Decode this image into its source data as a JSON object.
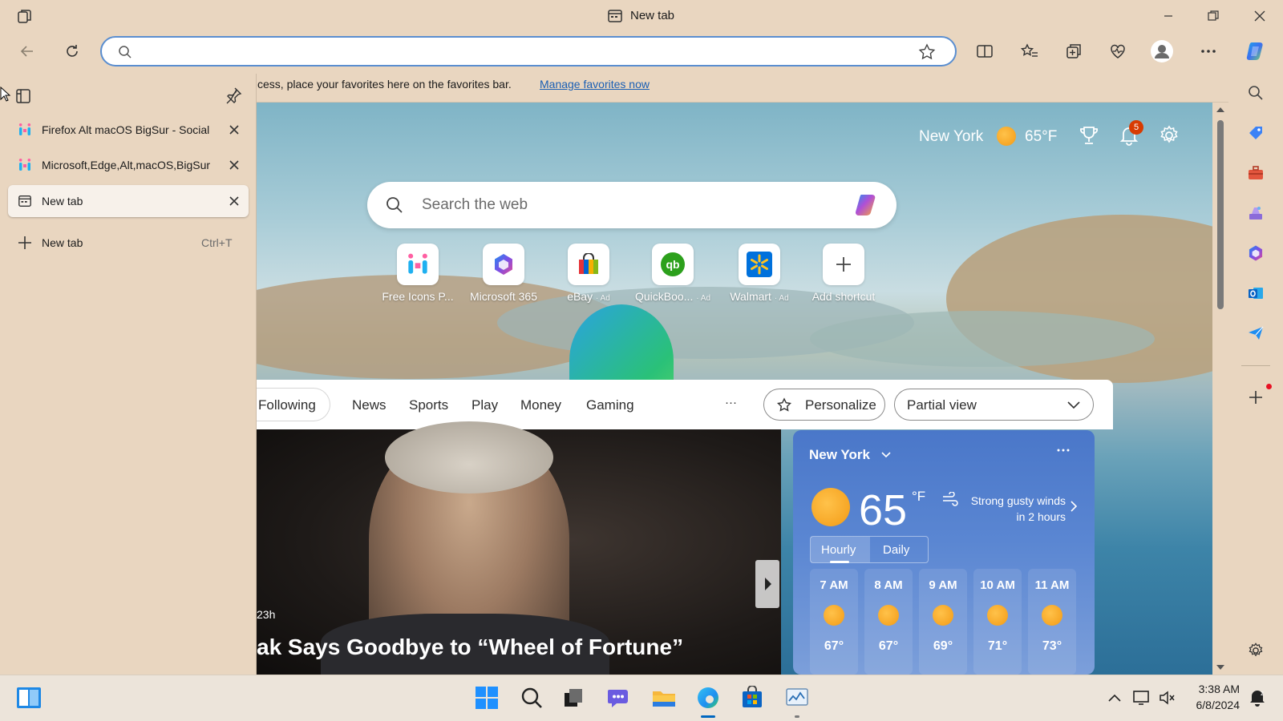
{
  "window": {
    "title": "New tab"
  },
  "address_bar": {
    "value": "",
    "placeholder": ""
  },
  "vertical_tabs": {
    "tabs": [
      {
        "label": "Firefox Alt macOS BigSur - Social"
      },
      {
        "label": "Microsoft,Edge,Alt,macOS,BigSur"
      },
      {
        "label": "New tab",
        "active": true
      }
    ],
    "new_tab_label": "New tab",
    "new_tab_shortcut": "Ctrl+T"
  },
  "favorites_bar": {
    "message": "cess, place your favorites here on the favorites bar.",
    "link": "Manage favorites now"
  },
  "new_tab_page": {
    "weather_city": "New York",
    "weather_temp": "65°F",
    "notifications_count": "5",
    "search_placeholder": "Search the web",
    "shortcuts": [
      {
        "name": "Free Icons P...",
        "ad": "",
        "icon": "icons8-icon"
      },
      {
        "name": "Microsoft 365",
        "ad": "",
        "icon": "microsoft365-icon"
      },
      {
        "name": "eBay",
        "ad": "· Ad",
        "icon": "ebay-icon"
      },
      {
        "name": "QuickBoo...",
        "ad": "· Ad",
        "icon": "quickbooks-icon"
      },
      {
        "name": "Walmart",
        "ad": "· Ad",
        "icon": "walmart-icon"
      },
      {
        "name": "Add shortcut",
        "ad": "",
        "icon": "plus-icon"
      }
    ]
  },
  "feed": {
    "nav": [
      "Following",
      "News",
      "Sports",
      "Play",
      "Money",
      "Gaming"
    ],
    "more": "···",
    "personalize": "Personalize",
    "view_mode": "Partial view",
    "hero": {
      "age": "23h",
      "title": "ak Says Goodbye to “Wheel of Fortune”"
    }
  },
  "weather_card": {
    "city": "New York",
    "temp": "65",
    "unit": "°F",
    "alert": "Strong gusty winds in 2 hours",
    "tabs": [
      "Hourly",
      "Daily"
    ],
    "hourly": [
      {
        "time": "7 AM",
        "temp": "67°"
      },
      {
        "time": "8 AM",
        "temp": "67°"
      },
      {
        "time": "9 AM",
        "temp": "69°"
      },
      {
        "time": "10 AM",
        "temp": "71°"
      },
      {
        "time": "11 AM",
        "temp": "73°"
      }
    ]
  },
  "taskbar": {
    "time": "3:38 AM",
    "date": "6/8/2024"
  },
  "colors": {
    "accent": "#1a5fb4",
    "address_border": "#5a8ed0",
    "chrome_bg": "#e9d6c0",
    "badge": "#d83b01"
  }
}
